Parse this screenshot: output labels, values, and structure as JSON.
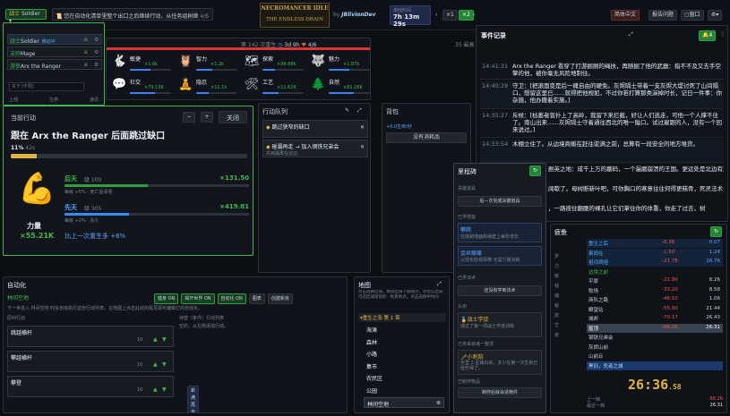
{
  "topbar": {
    "char_role": "战士",
    "char_name": "Soldier",
    "notice": "您在自动化清单里整个出口之后继续行动，从任务组树继",
    "notice_count": "4/6",
    "logo_line1": "NECROMANCER IDLE",
    "logo_line2": "THE ENDLESS DRAIN",
    "by": "by",
    "author": "JBlivionDev",
    "timer_label": "离线时间",
    "timer_value": "7h 13m 29s",
    "speed_x1": "×1",
    "speed_x2": "×2",
    "lang": "简体中文",
    "feedback": "报告问题",
    "window": "窗口",
    "gear": "⚙"
  },
  "party": {
    "members": [
      {
        "role": "战士",
        "name": "Soldier",
        "tag": "移动中"
      },
      {
        "role": "法师",
        "name": "Mage",
        "tag": ""
      },
      {
        "role": "游侠",
        "name": "Arx the Ranger",
        "tag": ""
      }
    ],
    "search_placeholder": "关于 (不限)",
    "footer_a": "上线",
    "footer_b": "生命",
    "footer_c": "通讯"
  },
  "stats": {
    "header": "第 142 次重生",
    "age": "3d 9h",
    "hp": "4/6",
    "right": "35 最高",
    "items": [
      {
        "name": "敏捷",
        "val": "×1.6k",
        "icon": "🐇",
        "fill": 0.5
      },
      {
        "name": "智力",
        "val": "×1.2k",
        "icon": "🦉",
        "fill": 0.4
      },
      {
        "name": "探索",
        "val": "×96.88k",
        "icon": "🗺",
        "fill": 0.3
      },
      {
        "name": "魅力",
        "val": "×1.87k",
        "icon": "🐺",
        "fill": 0.5
      },
      {
        "name": "社交",
        "val": "×79.13K",
        "icon": "💬",
        "fill": 0.6
      },
      {
        "name": "隐忍",
        "val": "×11.1k",
        "icon": "🧘",
        "fill": 0.3
      },
      {
        "name": "工艺",
        "val": "×11.62K",
        "icon": "🛠",
        "fill": 0.4
      },
      {
        "name": "自然",
        "val": "×81.26K",
        "icon": "🌲",
        "fill": 0.6
      }
    ]
  },
  "action": {
    "title": "当前行动",
    "name": "跟在 Arx the Ranger 后面跳过缺口",
    "pct": "11%",
    "time": "42s",
    "progress": 0.11,
    "minus": "−",
    "plus": "+",
    "close": "关闭",
    "stat_name": "力量",
    "stat_value": "×55.21K",
    "rows": [
      {
        "label": "后天",
        "level": "级 100",
        "mult": "×131.50",
        "sub": "每级 +5% · 死亡后清零",
        "fill": 0.45
      },
      {
        "label": "先天",
        "level": "级 305",
        "mult": "×419.81",
        "sub": "每级 +2% · 永久",
        "fill": 0.35
      }
    ],
    "footer_label": "比上一次重生多",
    "footer_value": "+6%"
  },
  "queue": {
    "title": "行动队列",
    "items": [
      {
        "title": "跳过狭窄的缺口",
        "sub": ""
      },
      {
        "title": "碰漏再走 → 加入钢铁兄弟会",
        "sub": "先到漏再在这边"
      }
    ]
  },
  "pack": {
    "title": "背包",
    "gold": "+0.0生命/秒",
    "empty": "没有消耗品"
  },
  "log": {
    "title": "事件记录",
    "badge": "4",
    "entries": [
      {
        "time": "14:41:31",
        "text": "Arx the Ranger 看穿了打游掘刷的绳扶，再随掘了他的武器：指不不及又去手空擎的他，被你毫无风险地制住。"
      },
      {
        "time": "14:40:29",
        "text": "守卫：[把滚面变是后一瘫自由的硬免。灰烬隔士带着一支灰烬大堤讨死了山间隔口，想留这里已……就得把他规如，不过你若打算那类演掉时长，记日一件事：你杂施，他办撒着实施。]"
      },
      {
        "time": "14:35:27",
        "text": "斥候：[枯萎者曾扑上了高岭，我留下来拦截，好让人们逃走，可他一个人撑不住了。南山出来……灰烬隔士守着通往西北的唯一隘口。试过雇跟的人，没有一个回来说过。]"
      },
      {
        "time": "14:33:54",
        "text": "木棚立住了。从边境商贩在赶往驼满之前，总算有一段安全的地方堆货。"
      }
    ],
    "overflow": [
      "剧英之地：成千上万的墓码，一个漏磨崩溃的王国。更远处是北边有漏到。",
      "阔歇了，母树断新叶吧，可你胸口的寒意往往何得更糕骨，死灵法术一些正在准备。",
      "，一路按住翻腰的裸孔让它们掌住你的体重，你走了过去，树"
    ]
  },
  "milestone": {
    "title": "里程碑",
    "section1": "关键道具",
    "next": "后—次完成关键道具",
    "section2": "已学技能",
    "skills": [
      {
        "name": "攀爬",
        "desc": "在陡峭墙面和峭壁上每秒增长"
      },
      {
        "name": "金丝藤藤",
        "desc": "以轻松轻易挥攀·无需力量消耗"
      }
    ],
    "section3": "已学法术",
    "spell_empty": "还没有学到法术",
    "section4": "头衔",
    "title_name": "战士学徒",
    "title_desc": "通过了第一项战士学徒训练",
    "section5": "已未来就绪一整顶",
    "next_name": "小刺刮",
    "next_desc": "手里 2 星铺出来，多少在第一次生就已经升得了。",
    "section6": "已制作物品",
    "craft_empty": "制作后就会造物件"
  },
  "fatigue": {
    "title": "疲惫",
    "sidecol": [
      "罗",
      "力",
      "敏",
      "钱",
      "魂",
      "秘",
      "技",
      "艺",
      "夜"
    ],
    "rows": [
      {
        "name": "重生之后",
        "d": "-0.36",
        "v": "0.07",
        "state": "up"
      },
      {
        "name": "案闻在",
        "d": "-1.50",
        "v": "1.24",
        "state": "up"
      },
      {
        "name": "祖词病祖",
        "d": "-21.78",
        "v": "16.76",
        "state": "up"
      },
      {
        "name": "边境之前",
        "d": "",
        "v": "",
        "state": "head"
      },
      {
        "name": "平原",
        "d": "-21.90",
        "v": "8.26",
        "state": ""
      },
      {
        "name": "牧场",
        "d": "-33.20",
        "v": "8.58",
        "state": ""
      },
      {
        "name": "商队之路",
        "d": "-46.10",
        "v": "1.06",
        "state": ""
      },
      {
        "name": "瞭望站",
        "d": "-55.90",
        "v": "21.44",
        "state": ""
      },
      {
        "name": "城邦",
        "d": "-70.17",
        "v": "26.43",
        "state": ""
      },
      {
        "name": "屋顶",
        "d": "-66.26",
        "v": "26:31",
        "state": "sel"
      },
      {
        "name": "钢铁兄弟会",
        "d": "",
        "v": "",
        "state": ""
      },
      {
        "name": "灰烬山前",
        "d": "",
        "v": "",
        "state": ""
      },
      {
        "name": "山前丘",
        "d": "",
        "v": "",
        "state": ""
      },
      {
        "name": "黑旧，死者之城",
        "d": "",
        "v": "",
        "state": "blue"
      }
    ],
    "clock": "26:36",
    "clock_ms": ".58",
    "f1_label": "上一档",
    "f1_v": "-66.26",
    "f2_label": "最近一档",
    "f2_v": "26.31"
  },
  "auto": {
    "title": "自动化",
    "tab": "林间空地",
    "toggles": [
      "健身 ON",
      "揭开世界 ON",
      "自动化 ON",
      "图表",
      "创建新房"
    ],
    "hint": "下一世进入 林间空地 时会自动执行这份行动列表。在地图上点击此处的看见即可编辑它的自动化。",
    "col1": "原利行动",
    "col2": "待替（条件）行动列表",
    "col2_sub": "空的，从左侧添加行动。",
    "rows": [
      {
        "name": "跳越横杆",
        "num": "10"
      },
      {
        "name": "攀越横杆",
        "num": "10"
      },
      {
        "name": "攀登",
        "num": "10",
        "extra": "新满再走"
      }
    ]
  },
  "map": {
    "title": "地图",
    "hint": "点击选择区域，拖动区域下级图示，点位以出前可选区域级别的 · 拖目地点，点击选择中时间",
    "chapter": "重生之岛 第 1 章",
    "places": [
      "海滩",
      "森林",
      "小路",
      "集市",
      "农民区",
      "公园",
      "林间空地"
    ]
  }
}
